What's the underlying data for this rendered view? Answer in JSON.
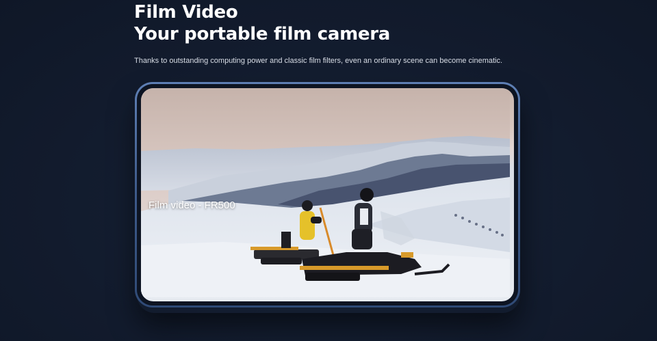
{
  "heading": {
    "line1": "Film Video",
    "line2": "Your portable film camera"
  },
  "description": "Thanks to outstanding computing power and classic film filters, even an ordinary scene can become cinematic.",
  "video": {
    "caption": "Film video - FR500"
  },
  "colors": {
    "background": "#131d31",
    "frame": "#4a6aa0",
    "text": "#ffffff"
  }
}
